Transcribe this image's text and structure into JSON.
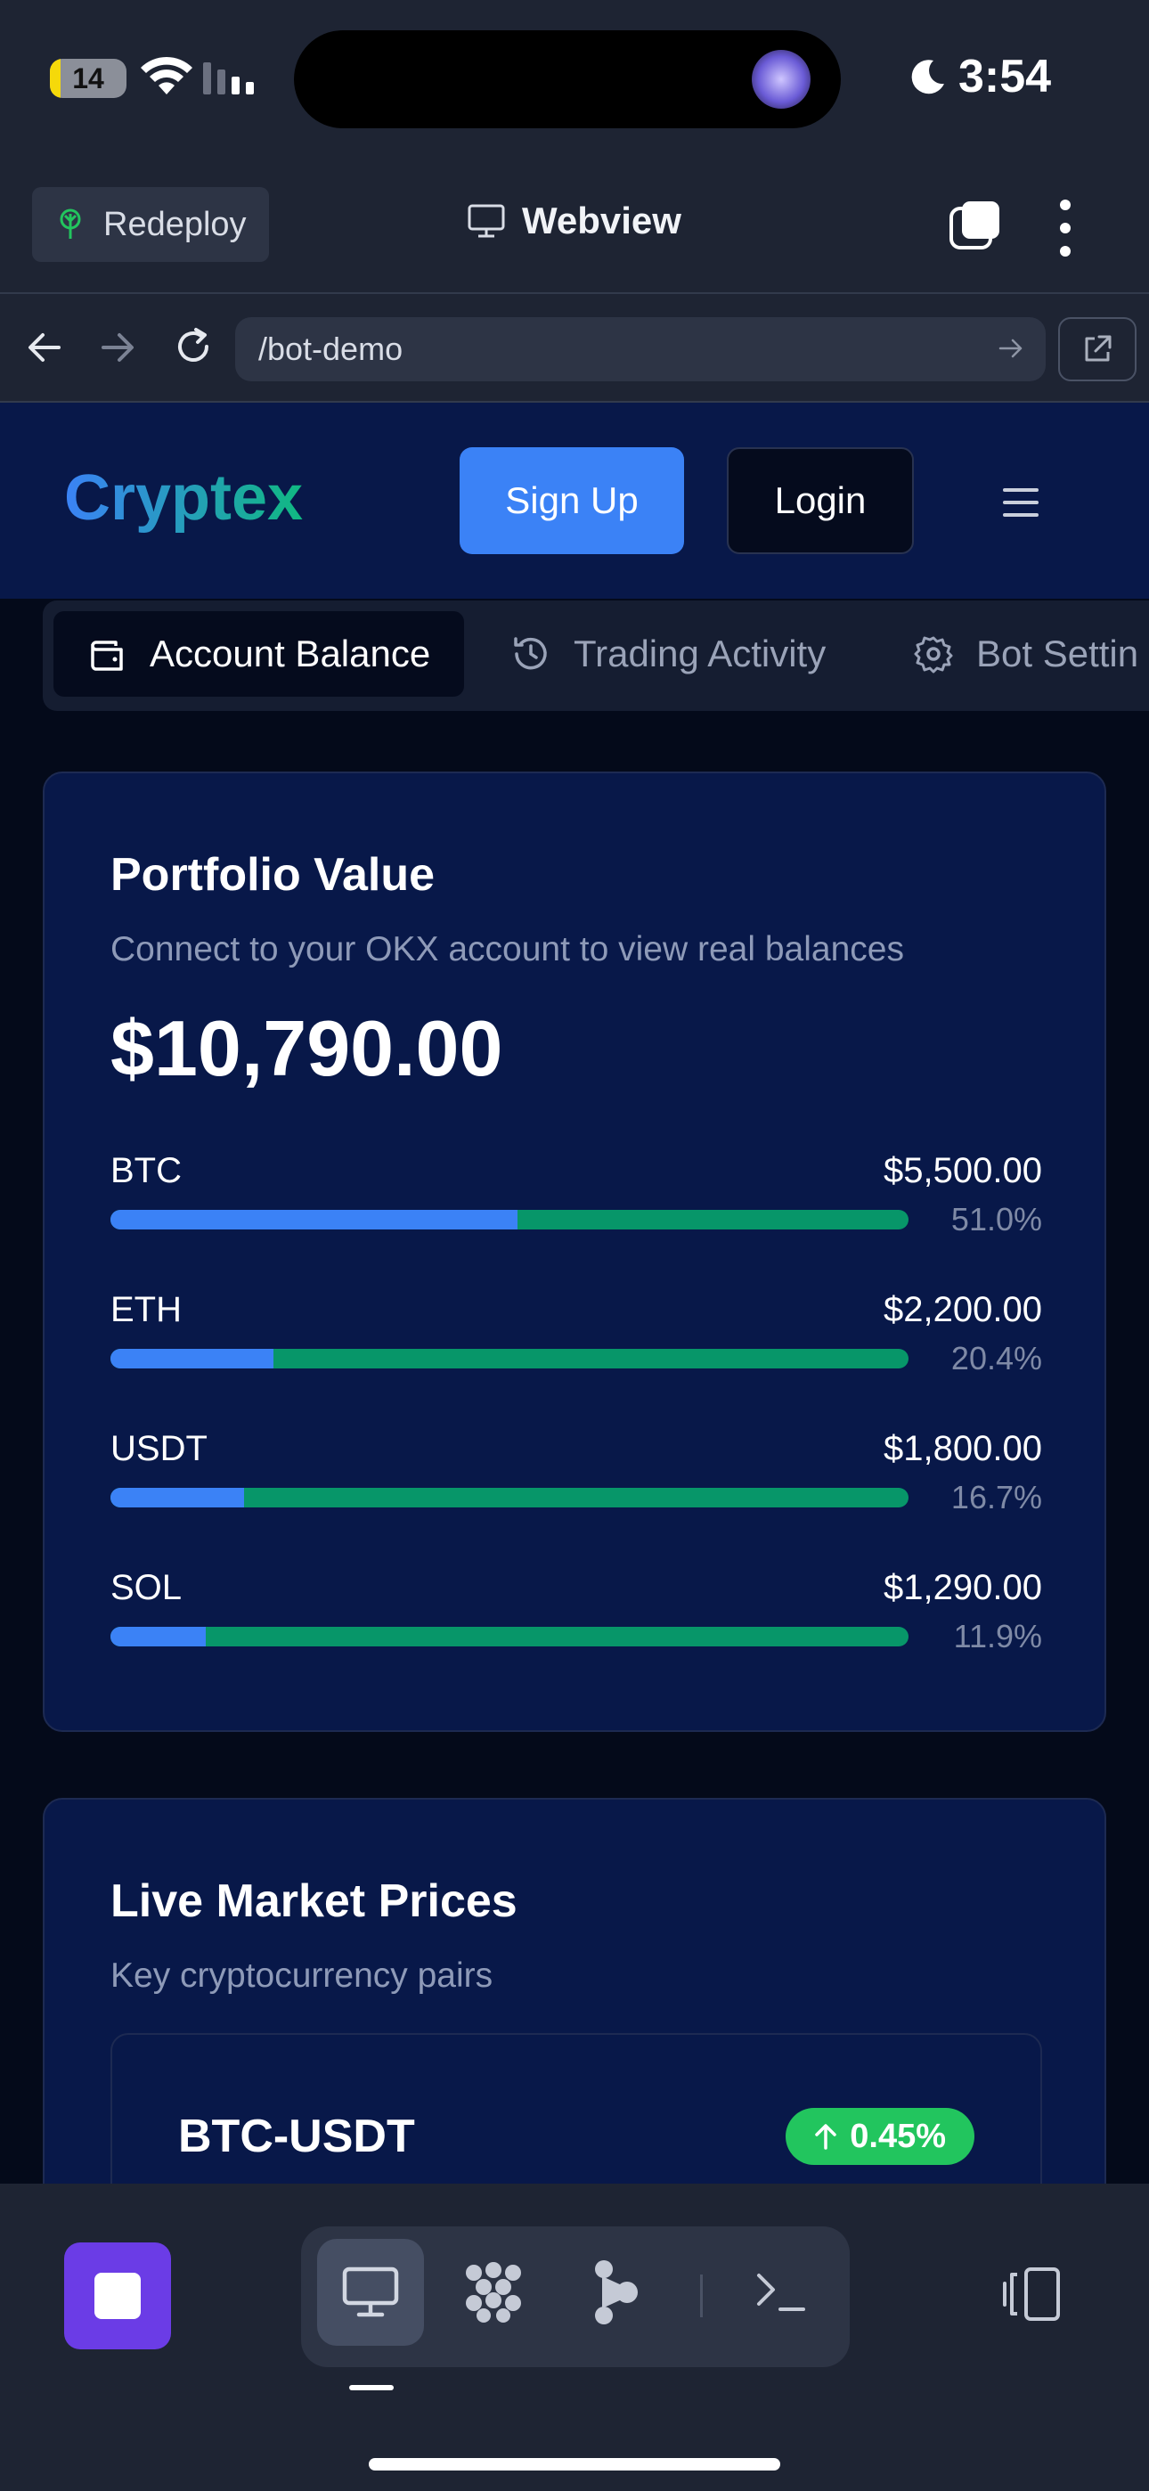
{
  "status_bar": {
    "battery_level": "14",
    "battery_fraction": 0.14,
    "time": "3:54",
    "icons": [
      "battery-icon",
      "wifi-icon",
      "cellular-signal-icon",
      "flashlight-icon",
      "moon-icon"
    ]
  },
  "toolbar": {
    "redeploy_label": "Redeploy",
    "title": "Webview",
    "icons": [
      "replit-leaf-icon",
      "monitor-icon",
      "tabs-icon",
      "more-vert-icon"
    ]
  },
  "url_bar": {
    "url": "/bot-demo",
    "icons": [
      "back-arrow-icon",
      "forward-arrow-icon",
      "reload-icon",
      "go-arrow-icon",
      "open-external-icon"
    ]
  },
  "site": {
    "logo": "Cryptex",
    "signup_label": "Sign Up",
    "login_label": "Login",
    "colors": {
      "primary": "#3b82f6",
      "green": "#079669",
      "header_bg": "#081849",
      "page_bg": "#040a1a"
    }
  },
  "tabs": [
    {
      "label": "Account Balance",
      "icon": "wallet-icon",
      "active": true
    },
    {
      "label": "Trading Activity",
      "icon": "history-icon",
      "active": false
    },
    {
      "label": "Bot Settin",
      "icon": "gear-icon",
      "active": false
    }
  ],
  "portfolio": {
    "title": "Portfolio Value",
    "subtitle": "Connect to your OKX account to view real balances",
    "total": "$10,790.00",
    "assets": [
      {
        "symbol": "BTC",
        "amount": "$5,500.00",
        "percent": "51.0%",
        "fraction": 0.51
      },
      {
        "symbol": "ETH",
        "amount": "$2,200.00",
        "percent": "20.4%",
        "fraction": 0.204
      },
      {
        "symbol": "USDT",
        "amount": "$1,800.00",
        "percent": "16.7%",
        "fraction": 0.167
      },
      {
        "symbol": "SOL",
        "amount": "$1,290.00",
        "percent": "11.9%",
        "fraction": 0.119
      }
    ]
  },
  "market": {
    "title": "Live Market Prices",
    "subtitle": "Key cryptocurrency pairs",
    "pairs": [
      {
        "name": "BTC-USDT",
        "change": "0.45%",
        "direction": "up",
        "icon": "arrow-up-icon"
      }
    ]
  },
  "bottom_bar": {
    "icons": [
      "stop-icon",
      "monitor-icon",
      "dots-grid-icon",
      "workflow-icon",
      "terminal-icon",
      "rotate-device-icon"
    ]
  }
}
